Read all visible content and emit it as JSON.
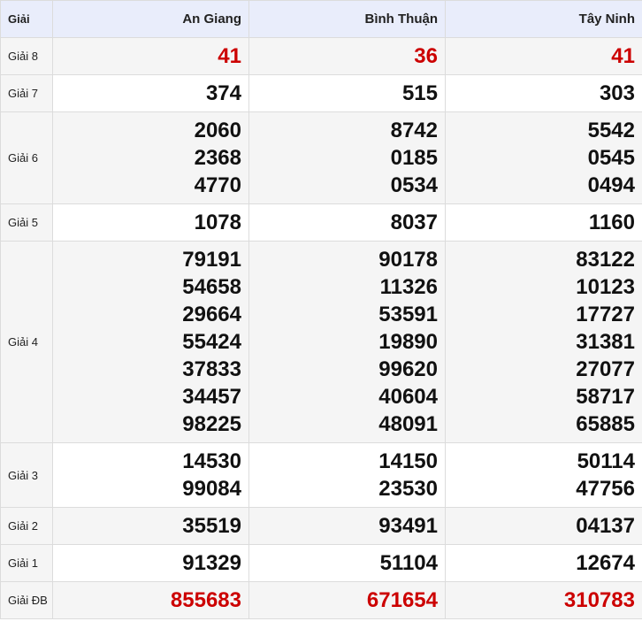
{
  "header": {
    "prize_col": "Giải",
    "provinces": [
      "An Giang",
      "Bình Thuận",
      "Tây Ninh"
    ]
  },
  "rows": [
    {
      "label": "Giải 8",
      "red": true,
      "values": [
        [
          "41"
        ],
        [
          "36"
        ],
        [
          "41"
        ]
      ]
    },
    {
      "label": "Giải 7",
      "red": false,
      "values": [
        [
          "374"
        ],
        [
          "515"
        ],
        [
          "303"
        ]
      ]
    },
    {
      "label": "Giải 6",
      "red": false,
      "values": [
        [
          "2060",
          "2368",
          "4770"
        ],
        [
          "8742",
          "0185",
          "0534"
        ],
        [
          "5542",
          "0545",
          "0494"
        ]
      ]
    },
    {
      "label": "Giải 5",
      "red": false,
      "values": [
        [
          "1078"
        ],
        [
          "8037"
        ],
        [
          "1160"
        ]
      ]
    },
    {
      "label": "Giải 4",
      "red": false,
      "values": [
        [
          "79191",
          "54658",
          "29664",
          "55424",
          "37833",
          "34457",
          "98225"
        ],
        [
          "90178",
          "11326",
          "53591",
          "19890",
          "99620",
          "40604",
          "48091"
        ],
        [
          "83122",
          "10123",
          "17727",
          "31381",
          "27077",
          "58717",
          "65885"
        ]
      ]
    },
    {
      "label": "Giải 3",
      "red": false,
      "values": [
        [
          "14530",
          "99084"
        ],
        [
          "14150",
          "23530"
        ],
        [
          "50114",
          "47756"
        ]
      ]
    },
    {
      "label": "Giải 2",
      "red": false,
      "values": [
        [
          "35519"
        ],
        [
          "93491"
        ],
        [
          "04137"
        ]
      ]
    },
    {
      "label": "Giải 1",
      "red": false,
      "values": [
        [
          "91329"
        ],
        [
          "51104"
        ],
        [
          "12674"
        ]
      ]
    },
    {
      "label": "Giải ĐB",
      "red": true,
      "values": [
        [
          "855683"
        ],
        [
          "671654"
        ],
        [
          "310783"
        ]
      ]
    }
  ],
  "colors": {
    "red": "#cc0000",
    "header_bg": "#e9edfb",
    "alt_bg": "#f5f5f5"
  }
}
